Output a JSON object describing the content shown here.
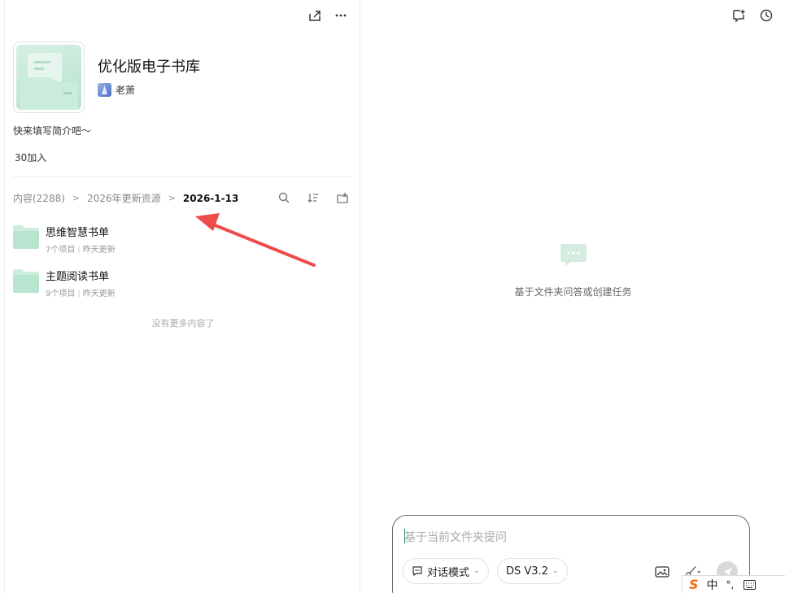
{
  "library": {
    "title": "优化版电子书库",
    "owner": "老萧",
    "intro": "快来填写简介吧～",
    "joined": "30加入"
  },
  "breadcrumb": {
    "items": [
      "内容(2288)",
      "2026年更新资源",
      "2026-1-13"
    ]
  },
  "folders": [
    {
      "name": "思维智慧书单",
      "count": "7个项目",
      "updated": "昨天更新"
    },
    {
      "name": "主题阅读书单",
      "count": "9个项目",
      "updated": "昨天更新"
    }
  ],
  "no_more": "没有更多内容了",
  "assistant": {
    "empty_text": "基于文件夹问答或创建任务",
    "input_placeholder": "基于当前文件夹提问",
    "mode_label": "对话模式",
    "model_label": "DS V3.2"
  },
  "ime": {
    "lang": "中",
    "punct": "°,"
  },
  "colors": {
    "folder": "#bfe6d3",
    "accent": "#1a8c5c",
    "arrow": "#ee4b4b"
  }
}
